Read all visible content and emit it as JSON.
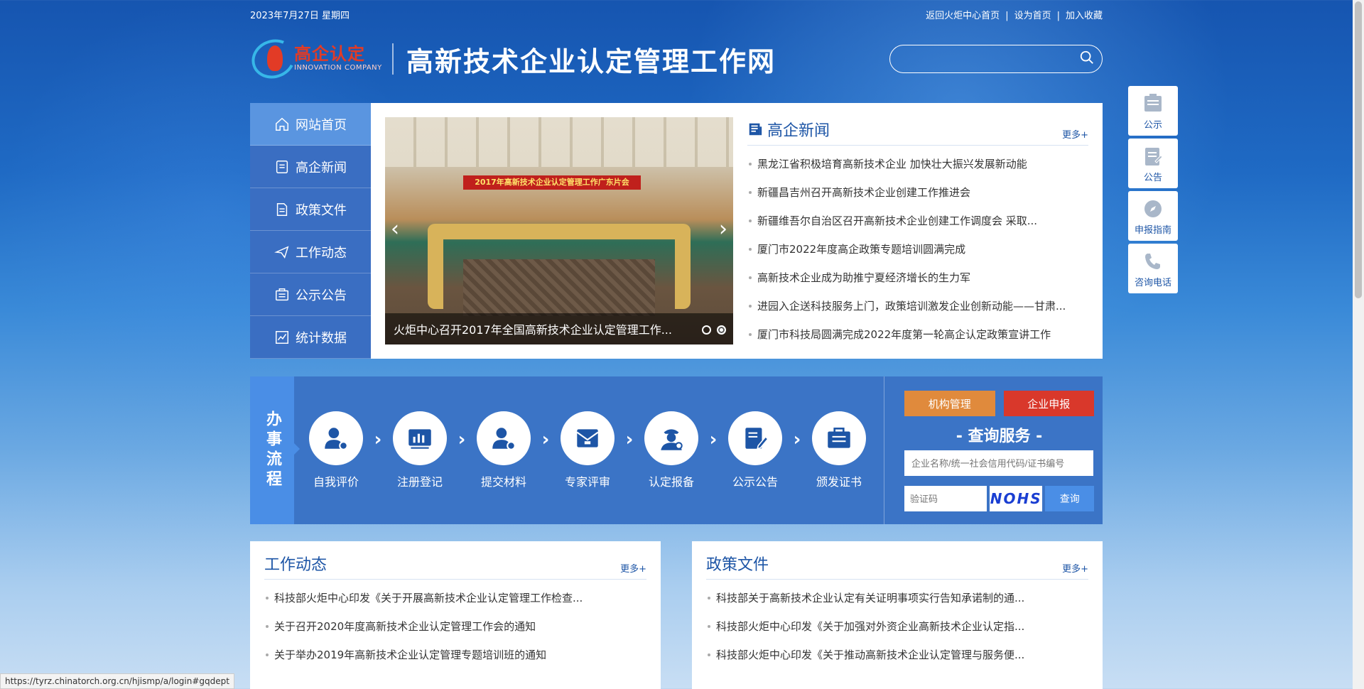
{
  "topbar": {
    "date": "2023年7月27日 星期四",
    "links": [
      "返回火炬中心首页",
      "设为首页",
      "加入收藏"
    ]
  },
  "header": {
    "logo_cn": "高企认定",
    "logo_en": "INNOVATION COMPANY",
    "site_title": "高新技术企业认定管理工作网",
    "search_placeholder": ""
  },
  "leftnav": [
    {
      "label": "网站首页",
      "icon": "home-icon",
      "active": true
    },
    {
      "label": "高企新闻",
      "icon": "document-icon"
    },
    {
      "label": "政策文件",
      "icon": "file-icon"
    },
    {
      "label": "工作动态",
      "icon": "send-icon"
    },
    {
      "label": "公示公告",
      "icon": "inbox-icon"
    },
    {
      "label": "统计数据",
      "icon": "chart-icon"
    }
  ],
  "carousel": {
    "banner_text": "2017年高新技术企业认定管理工作广东片会",
    "caption": "火炬中心召开2017年全国高新技术企业认定管理工作..."
  },
  "news": {
    "title": "高企新闻",
    "more": "更多+",
    "items": [
      "黑龙江省积极培育高新技术企业 加快壮大振兴发展新动能",
      "新疆昌吉州召开高新技术企业创建工作推进会",
      "新疆维吾尔自治区召开高新技术企业创建工作调度会 采取...",
      "厦门市2022年度高企政策专题培训圆满完成",
      "高新技术企业成为助推宁夏经济增长的生力军",
      "进园入企送科技服务上门，政策培训激发企业创新动能——甘肃...",
      "厦门市科技局圆满完成2022年度第一轮高企认定政策宣讲工作"
    ]
  },
  "process": {
    "label": "办事流程",
    "steps": [
      "自我评价",
      "注册登记",
      "提交材料",
      "专家评审",
      "认定报备",
      "公示公告",
      "颁发证书"
    ]
  },
  "query": {
    "btn_org": "机构管理",
    "btn_apply": "企业申报",
    "title": "- 查询服务 -",
    "input_placeholder": "企业名称/统一社会信用代码/证书编号",
    "code_placeholder": "验证码",
    "captcha": "NOHS",
    "submit": "查询"
  },
  "work": {
    "title": "工作动态",
    "more": "更多+",
    "items": [
      "科技部火炬中心印发《关于开展高新技术企业认定管理工作检查...",
      "关于召开2020年度高新技术企业认定管理工作会的通知",
      "关于举办2019年高新技术企业认定管理专题培训班的通知"
    ]
  },
  "policy": {
    "title": "政策文件",
    "more": "更多+",
    "items": [
      "科技部关于高新技术企业认定有关证明事项实行告知承诺制的通...",
      "科技部火炬中心印发《关于加强对外资企业高新技术企业认定指...",
      "科技部火炬中心印发《关于推动高新技术企业认定管理与服务便..."
    ]
  },
  "floatbar": [
    {
      "label": "公示",
      "icon": "notice-icon"
    },
    {
      "label": "公告",
      "icon": "clipboard-icon"
    },
    {
      "label": "申报指南",
      "icon": "compass-icon"
    },
    {
      "label": "咨询电话",
      "icon": "phone-icon"
    }
  ],
  "statusbar": "https://tyrz.chinatorch.org.cn/hjismp/a/login#gqdept"
}
